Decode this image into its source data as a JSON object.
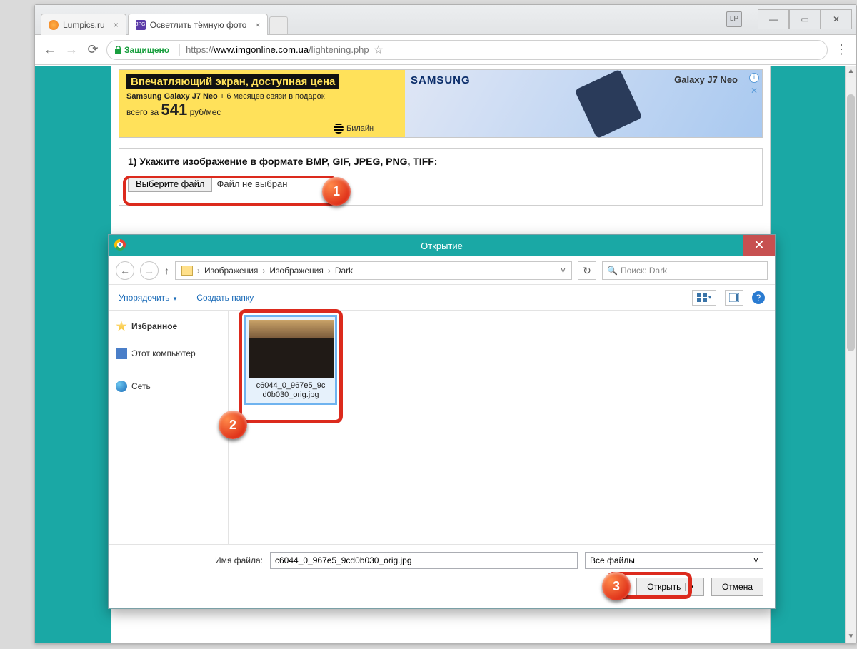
{
  "window": {
    "lp_badge": "LP",
    "minimize": "—",
    "maximize": "▭",
    "close": "✕"
  },
  "tabs": {
    "tab1": {
      "label": "Lumpics.ru",
      "close": "×"
    },
    "tab2": {
      "label": "Осветлить тёмную фото",
      "close": "×",
      "favicon_text": "JPG"
    }
  },
  "addr": {
    "back": "←",
    "fwd": "→",
    "reload": "⟳",
    "secure": "Защищено",
    "scheme": "https://",
    "host": "www.imgonline.com.ua",
    "path": "/lightening.php",
    "star": "☆",
    "menu": "⋮"
  },
  "ad": {
    "headline": "Впечатляющий экран, доступная цена",
    "line1_a": "Samsung Galaxy J7 Neo",
    "line1_b": " + 6 месяцев связи в подарок",
    "price_pre": "всего за ",
    "price": "541",
    "price_post": " руб/мес",
    "beeline": "Билайн",
    "brand": "SAMSUNG",
    "product": "Galaxy J7 Neo",
    "info": "i",
    "x": "✕"
  },
  "step1": {
    "title": "1) Укажите изображение в формате BMP, GIF, JPEG, PNG, TIFF:",
    "choose": "Выберите файл",
    "nofile": "Файл не выбран"
  },
  "markers": {
    "m1": "1",
    "m2": "2",
    "m3": "3"
  },
  "dialog": {
    "title": "Открытие",
    "close": "✕",
    "nav": {
      "back": "←",
      "fwd": "→",
      "up": "↑",
      "crumb1": "Изображения",
      "crumb2": "Изображения",
      "crumb3": "Dark",
      "sep": "›",
      "dd": "˅",
      "refresh": "↻",
      "search_ph": "Поиск: Dark",
      "search_icon": "🔍"
    },
    "toolbar": {
      "organize": "Упорядочить",
      "dd": "▾",
      "newfolder": "Создать папку",
      "help": "?"
    },
    "navpane": {
      "fav": "Избранное",
      "pc": "Этот компьютер",
      "net": "Сеть"
    },
    "file": {
      "name_line1": "c6044_0_967e5_9c",
      "name_line2": "d0b030_orig.jpg"
    },
    "bottom": {
      "label": "Имя файла:",
      "value": "c6044_0_967e5_9cd0b030_orig.jpg",
      "type": "Все файлы",
      "dd": "˅",
      "open": "Открыть",
      "open_dd": "▾",
      "cancel": "Отмена"
    }
  }
}
